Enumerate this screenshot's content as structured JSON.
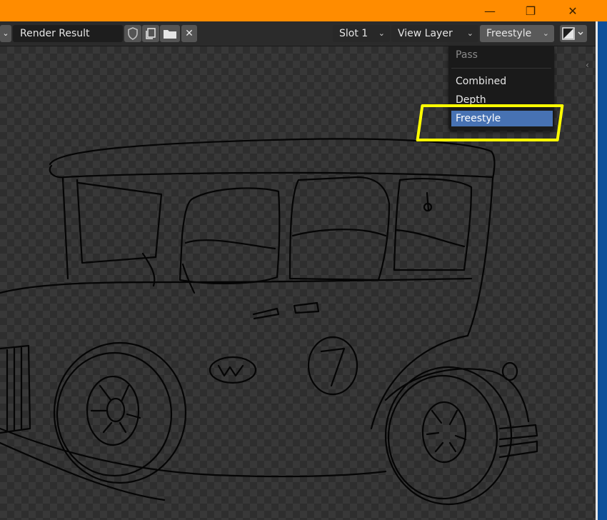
{
  "window": {
    "minimize_icon": "minimize-icon",
    "maximize_icon": "restore-icon",
    "close_icon": "close-icon"
  },
  "header": {
    "image_name": "Render Result",
    "slot": "Slot 1",
    "view_layer": "View Layer",
    "pass": "Freestyle",
    "icons": [
      "shield-icon",
      "duplicate-icon",
      "folder-icon",
      "close-icon",
      "display-mode-icon"
    ]
  },
  "pass_menu": {
    "title": "Pass",
    "items": [
      "Combined",
      "Depth",
      "Freestyle"
    ],
    "selected": "Freestyle"
  },
  "colors": {
    "titlebar": "#ff8c00",
    "highlight_box": "#ffff00",
    "selected_item": "#4772b3"
  }
}
